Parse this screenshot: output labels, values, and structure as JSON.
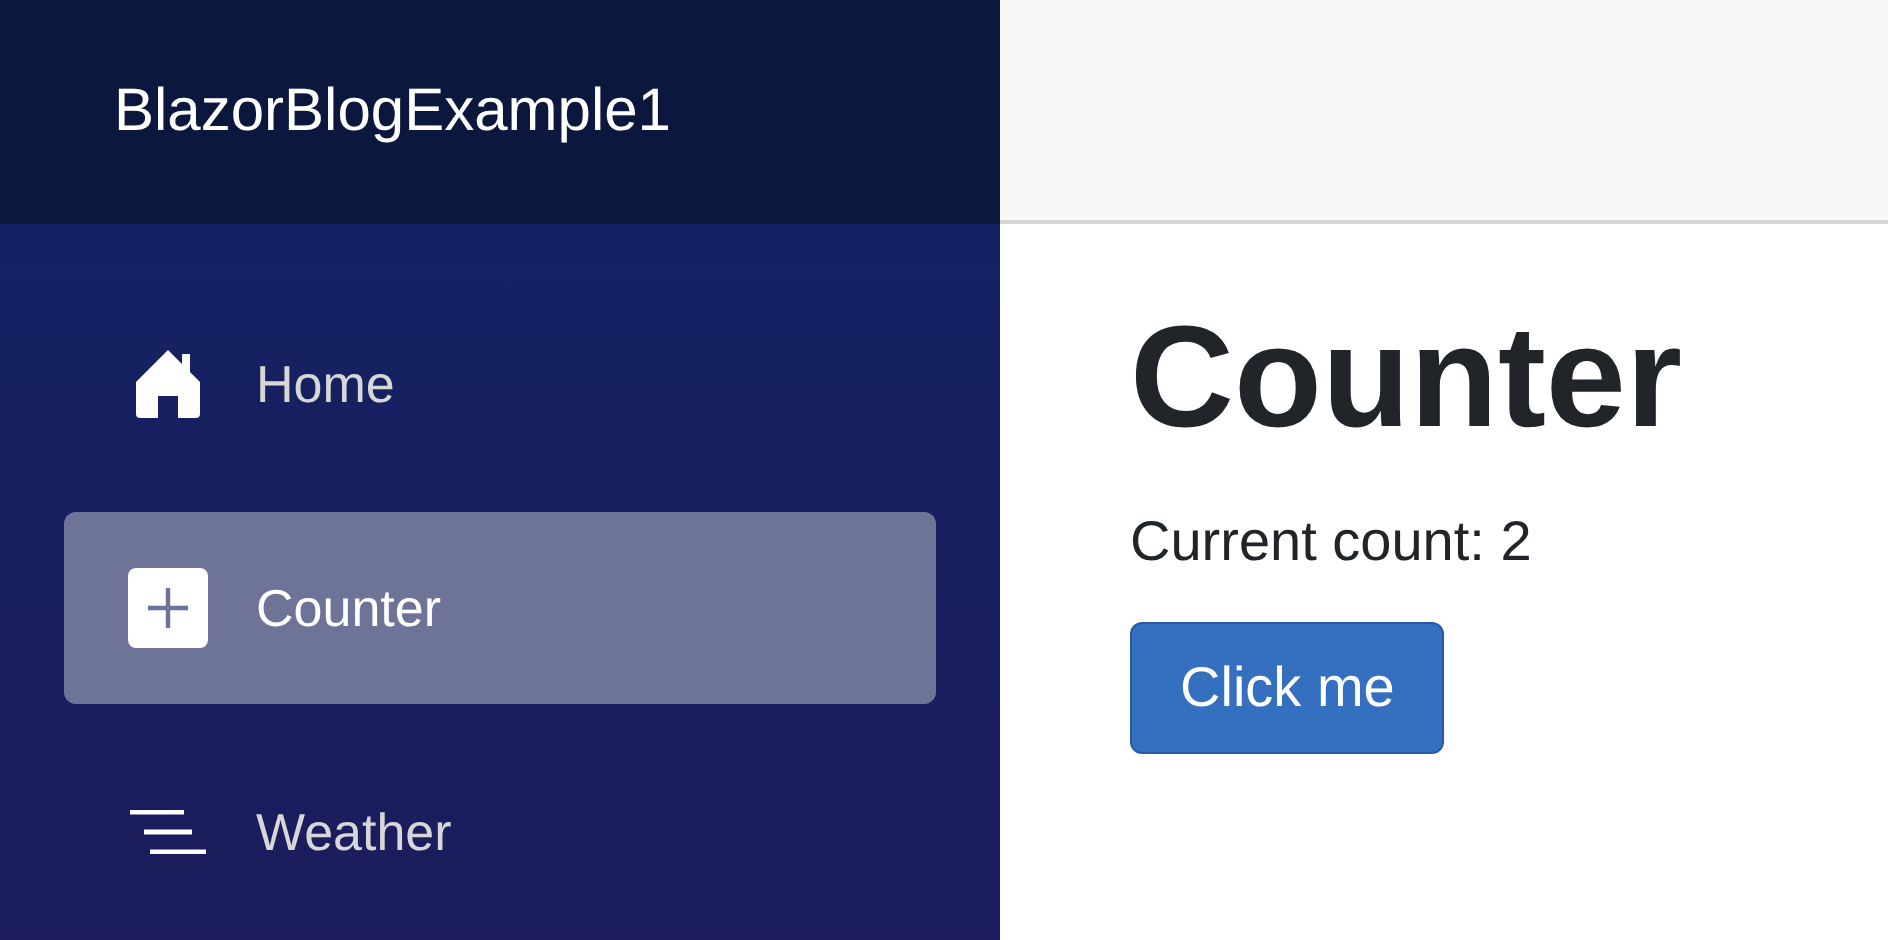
{
  "sidebar": {
    "brand": "BlazorBlogExample1",
    "items": [
      {
        "label": "Home",
        "selected": false
      },
      {
        "label": "Counter",
        "selected": true
      },
      {
        "label": "Weather",
        "selected": false
      }
    ]
  },
  "page": {
    "title": "Counter",
    "count_text": "Current count: 2",
    "button": "Click me"
  }
}
